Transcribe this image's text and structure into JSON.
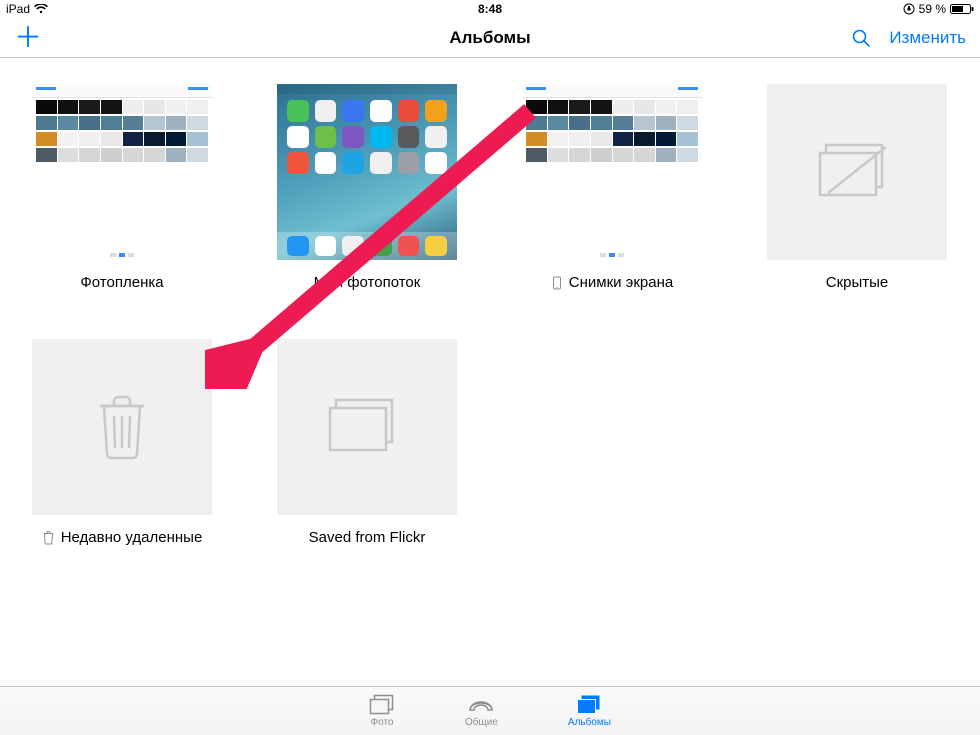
{
  "status": {
    "device": "iPad",
    "time": "8:48",
    "battery_text": "59 %"
  },
  "nav": {
    "title": "Альбомы",
    "edit_label": "Изменить"
  },
  "albums": [
    {
      "label": "Фотопленка",
      "icon": null
    },
    {
      "label": "Мой фотопоток",
      "icon": null
    },
    {
      "label": "Снимки экрана",
      "icon": "device"
    },
    {
      "label": "Скрытые",
      "icon": null
    },
    {
      "label": "Недавно удаленные",
      "icon": "trash"
    },
    {
      "label": "Saved from Flickr",
      "icon": null
    }
  ],
  "tabs": {
    "photos": "Фото",
    "shared": "Общие",
    "albums": "Альбомы"
  }
}
